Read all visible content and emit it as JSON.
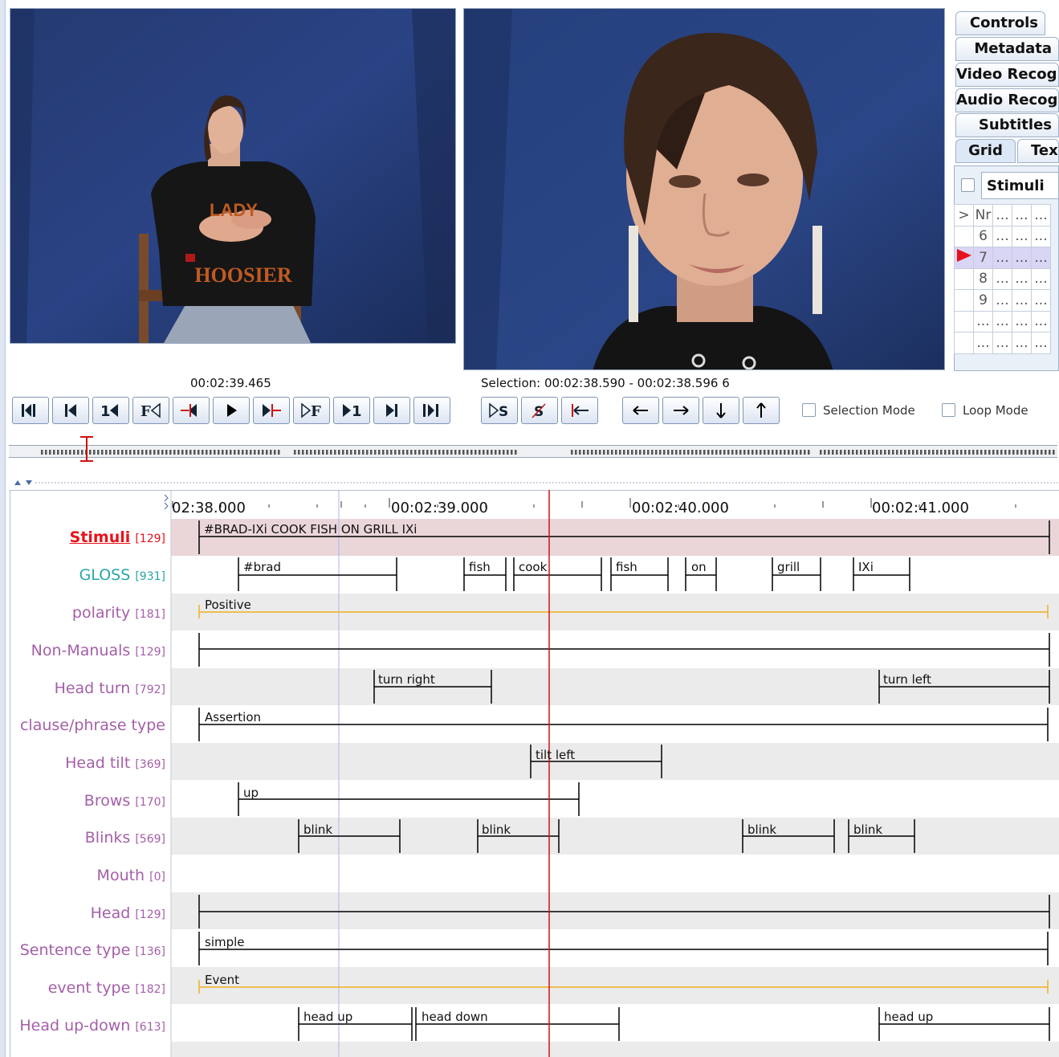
{
  "player": {
    "time": "00:02:39.465",
    "selection": "Selection: 00:02:38.590 - 00:02:38.596  6",
    "selection_mode_label": "Selection Mode",
    "loop_mode_label": "Loop Mode",
    "video1_shirt_text_top": "LADY",
    "video1_shirt_text_bottom": "HOOSIER"
  },
  "side_tabs": [
    "Controls",
    "Metadata",
    "Video Recogr",
    "Audio Recogr",
    "Subtitles",
    "Grid",
    "Tex"
  ],
  "grid": {
    "tier_name": "Stimuli",
    "header": [
      ">",
      "Nr",
      "...",
      "...",
      "..."
    ],
    "rows": [
      [
        "",
        "6",
        "...",
        "...",
        "..."
      ],
      [
        "",
        "7",
        "...",
        "...",
        "..."
      ],
      [
        "",
        "8",
        "...",
        "...",
        "..."
      ],
      [
        "",
        "9",
        "...",
        "...",
        "..."
      ],
      [
        "",
        "...",
        "...",
        "...",
        "..."
      ],
      [
        "",
        "...",
        "...",
        "...",
        "..."
      ]
    ]
  },
  "ruler": {
    "labels": [
      "02:38.000",
      "00:02:39.000",
      "00:02:40.000",
      "00:02:41.000"
    ]
  },
  "tiers": [
    {
      "name": "Stimuli",
      "count": "[129]"
    },
    {
      "name": "GLOSS",
      "count": "[931]"
    },
    {
      "name": "polarity",
      "count": "[181]"
    },
    {
      "name": "Non-Manuals",
      "count": "[129]"
    },
    {
      "name": "Head turn",
      "count": "[792]"
    },
    {
      "name": "clause/phrase type",
      "count": ""
    },
    {
      "name": "Head tilt",
      "count": "[369]"
    },
    {
      "name": "Brows",
      "count": "[170]"
    },
    {
      "name": "Blinks",
      "count": "[569]"
    },
    {
      "name": "Mouth",
      "count": "[0]"
    },
    {
      "name": "Head",
      "count": "[129]"
    },
    {
      "name": "Sentence type",
      "count": "[136]"
    },
    {
      "name": "event type",
      "count": "[182]"
    },
    {
      "name": "Head up-down",
      "count": "[613]"
    }
  ],
  "annotations": {
    "stimuli": "#BRAD-IXi COOK FISH ON GRILL IXi",
    "gloss": [
      "#brad",
      "fish",
      "cook",
      "fish",
      "on",
      "grill",
      "IXi"
    ],
    "polarity": "Positive",
    "head_turn": [
      "turn right",
      "turn left"
    ],
    "clause": "Assertion",
    "head_tilt": "tilt left",
    "brows": "up",
    "blinks": [
      "blink",
      "blink",
      "blink",
      "blink"
    ],
    "sentence_type": "simple",
    "event_type": "Event",
    "head_up_down": [
      "head up",
      "head down",
      "head up"
    ]
  },
  "colors": {
    "active_tier": "#e8121b",
    "gloss_tier": "#2aa6a8",
    "tier_label": "#a45fa8",
    "crosshair": "#d0101a",
    "polarity_line": "#f0b020",
    "stimuli_bg": "#ead6d9"
  }
}
